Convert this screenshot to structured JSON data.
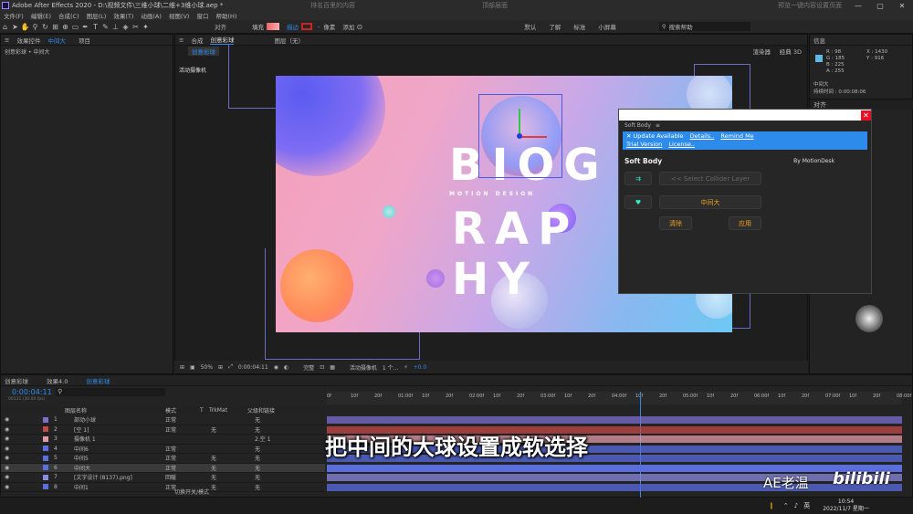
{
  "titlebar": {
    "title": "Adobe After Effects 2020 - D:\\视频文件\\三维小球\\二维+3维小球.aep *",
    "overlay1": "排名百里的内容",
    "overlay2": "顶部层面",
    "overlay3": "预览一键内容设置页面",
    "minimize": "—",
    "maximize": "▢",
    "close": "✕"
  },
  "menu": [
    "文件(F)",
    "编辑(E)",
    "合成(C)",
    "图层(L)",
    "效果(T)",
    "动画(A)",
    "视图(V)",
    "窗口",
    "帮助(H)"
  ],
  "toolbar": {
    "align": "对齐",
    "fill": "填充",
    "stroke": "描边",
    "dash": "-",
    "pixel": "像素",
    "add": "添加",
    "workspaces": [
      "默认",
      "了解",
      "标准",
      "小屏幕"
    ],
    "search_placeholder": "搜索帮助"
  },
  "left_panel": {
    "tab_effects": "效果控件",
    "tab_active": "中间大",
    "tab_project": "项目",
    "breadcrumb": "创意彩球 • 中间大"
  },
  "comp_panel": {
    "tab_label": "合成",
    "tab_active": "创意彩球",
    "tab_layer": "图层（无）",
    "subtab": "创意彩球",
    "renderer": "渲染器",
    "classic3d": "经典 3D",
    "camera_label": "活动摄像机"
  },
  "comp_art": {
    "line1": "BIOG",
    "line2": "RAP",
    "line3": "HY",
    "tagline": "MOTION DESIGN"
  },
  "viewer_footer": {
    "zoom": "50%",
    "timecode": "0:00:04:11",
    "quality": "完整",
    "camera": "活动摄像机",
    "views": "1 个...",
    "exposure": "+0.0"
  },
  "plugin": {
    "title": "Soft Body",
    "window_title": "Soft Body",
    "menu_icon": "≡",
    "update": "Update Available",
    "details": "Details..",
    "remind": "Remind Me",
    "trial": "Trial Version",
    "license": "License..",
    "brand": "Soft Body",
    "by": "By MotionDesk",
    "collider": "<< Select Collider Layer",
    "selected": "中间大",
    "clear": "清除",
    "apply": "应用",
    "close": "✕"
  },
  "info_panel": {
    "title": "信息",
    "r": "R : 98",
    "g": "G : 185",
    "b": "B : 225",
    "a": "A : 255",
    "x": "X : 1430",
    "y": "Y : 916",
    "layer": "中间大",
    "duration": "持续时间 : 0:00:08:06",
    "align_title": "对齐",
    "colors": {
      "swatch": "#62b9e1"
    }
  },
  "timeline": {
    "tabs": [
      "创意彩球",
      "效果4.0",
      "创意彩球"
    ],
    "timecode": "0:00:04:11",
    "frame_info": "00131 (30.00 fps)",
    "columns": {
      "name": "图层名称",
      "mode": "模式",
      "t": "T",
      "trkmat": "TrkMat",
      "parent": "父级和链接"
    },
    "footer": "切换开关/模式",
    "layers": [
      {
        "num": "1",
        "name": "部动小球",
        "mode": "正常",
        "trk": "",
        "parent": "无",
        "color": "#7b6fd0"
      },
      {
        "num": "2",
        "name": "[空 1]",
        "mode": "正常",
        "trk": "无",
        "parent": "无",
        "color": "#c54848"
      },
      {
        "num": "3",
        "name": "摄像机 1",
        "mode": "",
        "trk": "",
        "parent": "2.空 1",
        "color": "#e39aa8"
      },
      {
        "num": "4",
        "name": "中间6",
        "mode": "正常",
        "trk": "",
        "parent": "无",
        "color": "#5a6ee0"
      },
      {
        "num": "5",
        "name": "中间5",
        "mode": "正常",
        "trk": "无",
        "parent": "无",
        "color": "#5a6ee0"
      },
      {
        "num": "6",
        "name": "中间大",
        "mode": "正常",
        "trk": "无",
        "parent": "无",
        "color": "#5a6ee0"
      },
      {
        "num": "7",
        "name": "[文字设计 (8137).png]",
        "mode": "回暖",
        "trk": "无",
        "parent": "无",
        "color": "#8a8ae0"
      },
      {
        "num": "8",
        "name": "中间1",
        "mode": "正常",
        "trk": "无",
        "parent": "无",
        "color": "#5a6ee0"
      }
    ],
    "ruler": [
      "0f",
      "10f",
      "20f",
      "01:00f",
      "10f",
      "20f",
      "02:00f",
      "10f",
      "20f",
      "03:00f",
      "10f",
      "20f",
      "04:00f",
      "10f",
      "20f",
      "05:00f",
      "10f",
      "20f",
      "06:00f",
      "10f",
      "20f",
      "07:00f",
      "10f",
      "20f",
      "08:00f"
    ]
  },
  "subtitle": "把中间的大球设置成软选择",
  "watermark": "AE老温",
  "bilibili": "bilibili",
  "taskbar": {
    "ime": "英",
    "time": "10:54",
    "date": "2022/11/7 星期一"
  }
}
